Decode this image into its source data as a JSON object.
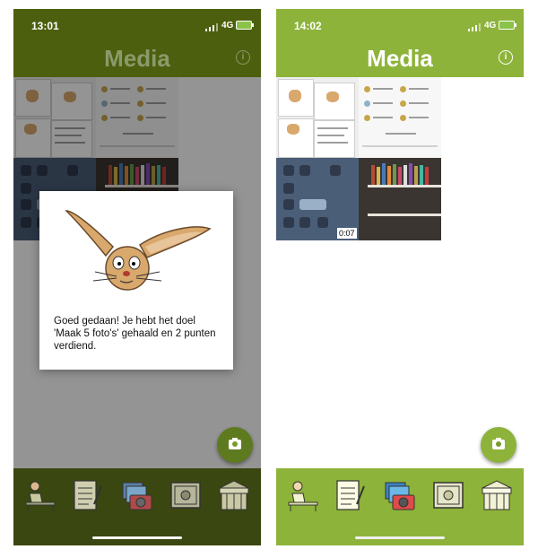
{
  "left": {
    "status_time": "13:01",
    "network": "4G",
    "title": "Media",
    "video_duration": "",
    "dialog_message": "Goed gedaan! Je hebt het doel 'Maak 5 foto's' gehaald en 2 punten verdiend."
  },
  "right": {
    "status_time": "14:02",
    "network": "4G",
    "title": "Media",
    "video_duration": "0:07"
  },
  "nav_items": [
    "student-at-desk-icon",
    "checklist-icon",
    "photos-camera-icon",
    "certificate-icon",
    "market-stall-icon"
  ],
  "colors": {
    "header_left": "#4c5f0e",
    "header_right": "#8db33a",
    "navbar_left": "#5e7312",
    "navbar_right": "#8db33a",
    "fab": "#8db33a"
  }
}
